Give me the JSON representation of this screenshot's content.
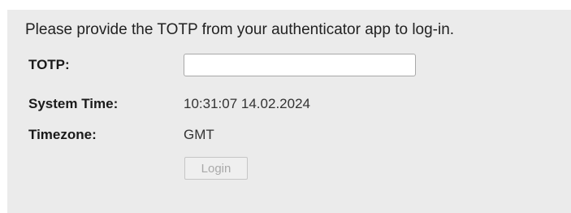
{
  "login": {
    "instruction": "Please provide the TOTP from your authenticator app to log-in.",
    "totp_label": "TOTP:",
    "totp_value": "",
    "totp_placeholder": "",
    "system_time_label": "System Time:",
    "system_time_value": "10:31:07  14.02.2024",
    "timezone_label": "Timezone:",
    "timezone_value": "GMT",
    "login_button_label": "Login",
    "login_button_state": "disabled"
  },
  "colors": {
    "panel_background": "#ebebeb",
    "text": "#222222",
    "disabled_button_text": "#a9a9a9"
  }
}
